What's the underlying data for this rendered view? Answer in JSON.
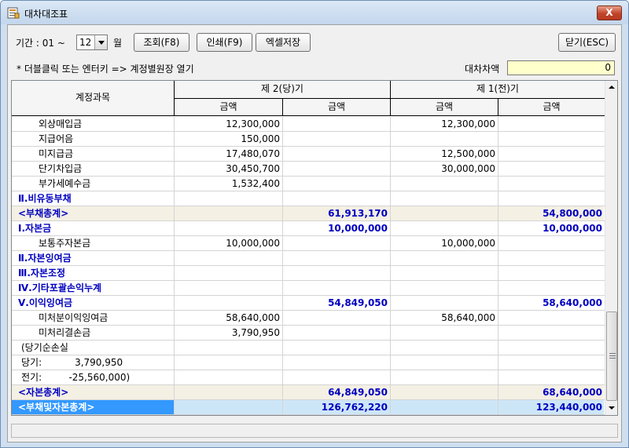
{
  "window": {
    "title": "대차대조표",
    "close_label": "X"
  },
  "toolbar": {
    "period_label": "기간 : 01 ~",
    "period_value": "12",
    "month_label": "월",
    "query_button": "조회(F8)",
    "print_button": "인쇄(F9)",
    "excel_button": "엑셀저장",
    "close_button": "닫기(ESC)"
  },
  "notice": "* 더블클릭 또는 엔터키 => 계정별원장 열기",
  "difference": {
    "label": "대차차액",
    "value": "0"
  },
  "grid": {
    "headers": {
      "account": "계정과목",
      "period2": "제 2(당)기",
      "period1": "제 1(전)기",
      "amount": "금액"
    },
    "rows": [
      {
        "name": "외상매입금",
        "c1": "12,300,000",
        "c2": "",
        "c3": "12,300,000",
        "c4": "",
        "type": "item"
      },
      {
        "name": "지급어음",
        "c1": "150,000",
        "c2": "",
        "c3": "",
        "c4": "",
        "type": "item"
      },
      {
        "name": "미지급금",
        "c1": "17,480,070",
        "c2": "",
        "c3": "12,500,000",
        "c4": "",
        "type": "item"
      },
      {
        "name": "단기차입금",
        "c1": "30,450,700",
        "c2": "",
        "c3": "30,000,000",
        "c4": "",
        "type": "item"
      },
      {
        "name": "부가세예수금",
        "c1": "1,532,400",
        "c2": "",
        "c3": "",
        "c4": "",
        "type": "item"
      },
      {
        "name": "Ⅱ.비유동부채",
        "c1": "",
        "c2": "",
        "c3": "",
        "c4": "",
        "type": "section"
      },
      {
        "name": "<부채총계>",
        "c1": "",
        "c2": "61,913,170",
        "c3": "",
        "c4": "54,800,000",
        "type": "total"
      },
      {
        "name": "Ⅰ.자본금",
        "c1": "",
        "c2": "10,000,000",
        "c3": "",
        "c4": "10,000,000",
        "type": "section"
      },
      {
        "name": "보통주자본금",
        "c1": "10,000,000",
        "c2": "",
        "c3": "10,000,000",
        "c4": "",
        "type": "item"
      },
      {
        "name": "Ⅱ.자본잉여금",
        "c1": "",
        "c2": "",
        "c3": "",
        "c4": "",
        "type": "section"
      },
      {
        "name": "Ⅲ.자본조정",
        "c1": "",
        "c2": "",
        "c3": "",
        "c4": "",
        "type": "section"
      },
      {
        "name": "Ⅳ.기타포괄손익누계",
        "c1": "",
        "c2": "",
        "c3": "",
        "c4": "",
        "type": "section"
      },
      {
        "name": "Ⅴ.이익잉여금",
        "c1": "",
        "c2": "54,849,050",
        "c3": "",
        "c4": "58,640,000",
        "type": "section"
      },
      {
        "name": "미처분이익잉여금",
        "c1": "58,640,000",
        "c2": "",
        "c3": "58,640,000",
        "c4": "",
        "type": "item"
      },
      {
        "name": "미처리결손금",
        "c1": "3,790,950",
        "c2": "",
        "c3": "",
        "c4": "",
        "type": "item"
      },
      {
        "name": "(당기순손실",
        "c1": "",
        "c2": "",
        "c3": "",
        "c4": "",
        "type": "note"
      },
      {
        "name": "당기:           3,790,950",
        "c1": "",
        "c2": "",
        "c3": "",
        "c4": "",
        "type": "note"
      },
      {
        "name": "전기:         -25,560,000)",
        "c1": "",
        "c2": "",
        "c3": "",
        "c4": "",
        "type": "note"
      },
      {
        "name": "<자본총계>",
        "c1": "",
        "c2": "64,849,050",
        "c3": "",
        "c4": "68,640,000",
        "type": "total"
      },
      {
        "name": "<부채및자본총계>",
        "c1": "",
        "c2": "126,762,220",
        "c3": "",
        "c4": "123,440,000",
        "type": "selected"
      }
    ]
  },
  "colors": {
    "section_text": "#0000c0",
    "selected_bg": "#3399ff",
    "total_bg": "#f4f0e4"
  }
}
